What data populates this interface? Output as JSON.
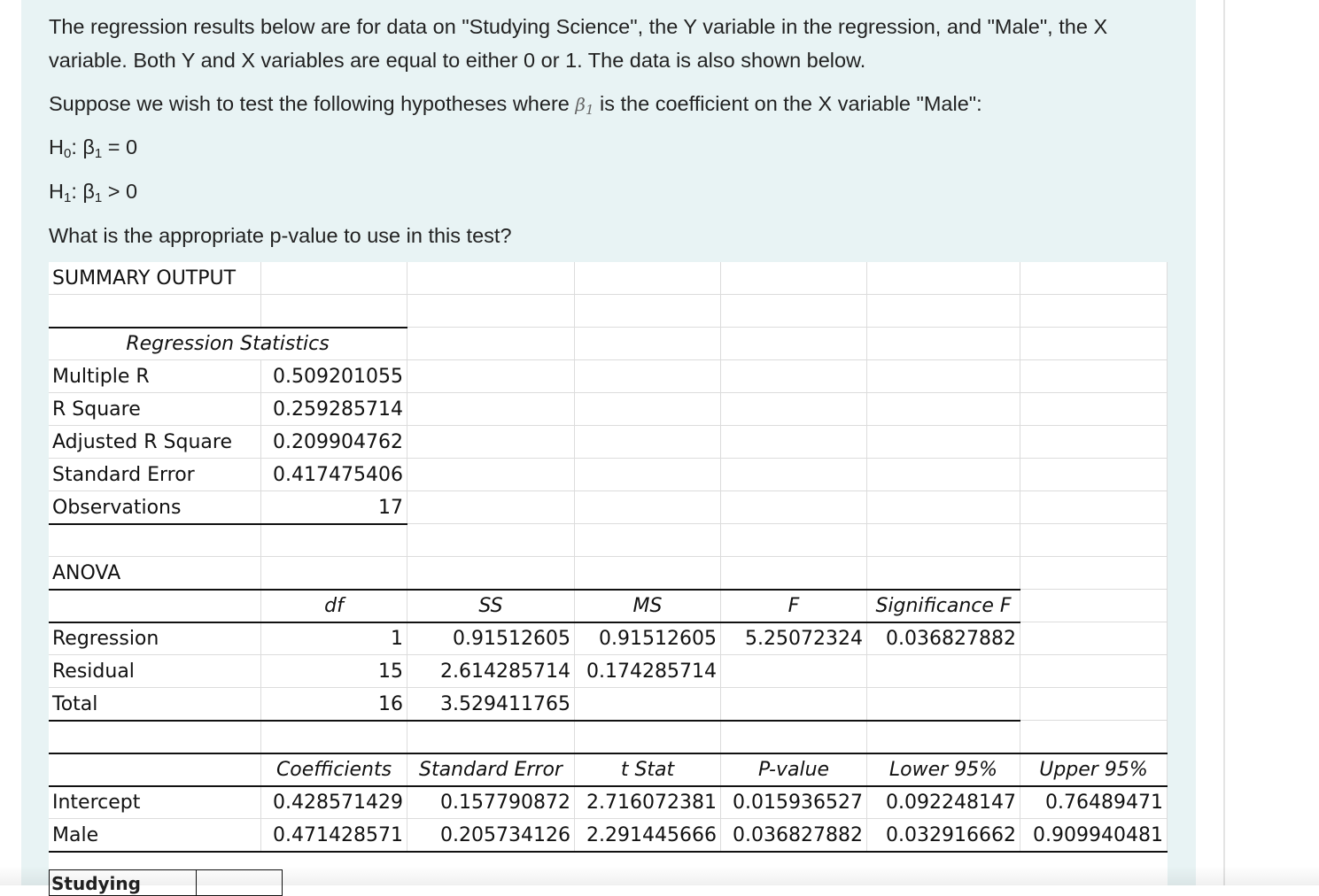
{
  "question": {
    "para1_line1": "The regression results below are for data on \"Studying Science\", the Y variable in the regression, and \"Male\", the X",
    "para1_line2": "variable. Both Y and X variables are equal to either 0 or 1. The data is also shown below.",
    "para2_before": "Suppose we wish to test the following hypotheses where ",
    "para2_beta": "β",
    "para2_beta_sub": "1",
    "para2_after": " is the coefficient on the X variable \"Male\":",
    "h0_prefix": "H",
    "h0_sub": "0",
    "h0_mid": ": β",
    "h0_beta_sub": "1",
    "h0_rest": " = 0",
    "h1_prefix": "H",
    "h1_sub": "1",
    "h1_mid": ": β",
    "h1_beta_sub": "1",
    "h1_rest": " > 0",
    "prompt": "What is the appropriate p-value to use in this test?"
  },
  "sheet": {
    "summary_title": "SUMMARY OUTPUT",
    "regstats_title": "Regression Statistics",
    "regstats": [
      {
        "label": "Multiple R",
        "value": "0.509201055"
      },
      {
        "label": "R Square",
        "value": "0.259285714"
      },
      {
        "label": "Adjusted R Square",
        "value": "0.209904762"
      },
      {
        "label": "Standard Error",
        "value": "0.417475406"
      },
      {
        "label": "Observations",
        "value": "17"
      }
    ],
    "anova_title": "ANOVA",
    "anova_headers": [
      "df",
      "SS",
      "MS",
      "F",
      "Significance F"
    ],
    "anova_rows": [
      {
        "label": "Regression",
        "df": "1",
        "ss": "0.91512605",
        "ms": "0.91512605",
        "f": "5.25072324",
        "sigf": "0.036827882"
      },
      {
        "label": "Residual",
        "df": "15",
        "ss": "2.614285714",
        "ms": "0.174285714",
        "f": "",
        "sigf": ""
      },
      {
        "label": "Total",
        "df": "16",
        "ss": "3.529411765",
        "ms": "",
        "f": "",
        "sigf": ""
      }
    ],
    "coef_headers": [
      "Coefficients",
      "Standard Error",
      "t Stat",
      "P-value",
      "Lower 95%",
      "Upper 95%"
    ],
    "coef_rows": [
      {
        "label": "Intercept",
        "values": [
          "0.428571429",
          "0.157790872",
          "2.716072381",
          "0.015936527",
          "0.092248147",
          "0.76489471"
        ]
      },
      {
        "label": "Male",
        "values": [
          "0.471428571",
          "0.205734126",
          "2.291445666",
          "0.036827882",
          "0.032916662",
          "0.909940481"
        ]
      }
    ]
  },
  "data_table": {
    "header_partial": "Studying"
  }
}
